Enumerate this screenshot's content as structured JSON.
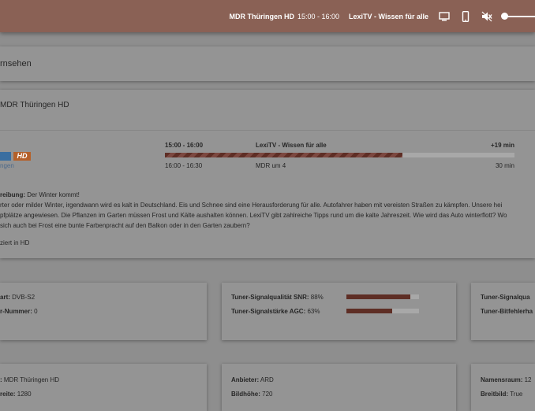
{
  "topbar": {
    "channel": "MDR Thüringen HD",
    "time": "15:00 - 16:00",
    "show": "LexiTV - Wissen für alle",
    "icons": [
      "tv-icon",
      "smartphone-icon",
      "volume-muted-icon",
      "volume-slider"
    ],
    "volume_level": 0
  },
  "page": {
    "title": "rnsehen"
  },
  "channel_card": {
    "name": "MDR Thüringen HD",
    "logo": {
      "badge": "HD",
      "sub": "ngen"
    },
    "epg": {
      "current": {
        "time": "15:00 - 16:00",
        "title": "LexiTV - Wissen für alle",
        "remaining": "+19 min",
        "progress": 0.68
      },
      "next": {
        "time": "16:00 - 16:30",
        "title": "MDR um 4",
        "duration": "30 min"
      }
    },
    "description": {
      "label": "reibung:",
      "title": " Der Winter kommt!",
      "lines": [
        "rter oder milder Winter, irgendwann wird es kalt in Deutschland. Eis und Schnee sind eine Herausforderung für alle. Autofahrer haben mit vereisten Straßen zu kämpfen. Unsere hei",
        "pfplätze angewiesen. Die Pflanzen im Garten müssen Frost und Kälte aushalten können. LexiTV gibt zahlreiche Tipps rund um die kalte Jahreszeit. Wie wird das Auto winterflott? Wo",
        "sich auch bei Frost eine bunte Farbenpracht auf den Balkon oder in den Garten zaubern?"
      ]
    },
    "hd_note": "ziert in HD"
  },
  "tuner_cards": {
    "c1": {
      "row1_label": "art:",
      "row1_value": " DVB-S2",
      "row2_label": "r-Nummer:",
      "row2_value": " 0"
    },
    "c2": {
      "snr_label": "Tuner-Signalqualität SNR:",
      "snr_value": " 88%",
      "snr_level": 0.88,
      "agc_label": "Tuner-Signalstärke AGC:",
      "agc_value": " 63%",
      "agc_level": 0.63
    },
    "c3": {
      "row1_label": "Tuner-Signalqua",
      "row2_label": "Tuner-Bitfehlerha"
    }
  },
  "info_cards": {
    "c1": {
      "row1_label": ":",
      "row1_value": " MDR Thüringen HD",
      "row2_label": "reite:",
      "row2_value": " 1280"
    },
    "c2": {
      "row1_label": "Anbieter:",
      "row1_value": " ARD",
      "row2_label": "Bildhöhe:",
      "row2_value": " 720"
    },
    "c3": {
      "row1_label": "Namensraum:",
      "row1_value": " 12",
      "row2_label": "Breitbild:",
      "row2_value": " True"
    }
  },
  "colors": {
    "topbar": "#8a6155",
    "progress": "#5e2e25",
    "background": "#8e8e8e"
  }
}
